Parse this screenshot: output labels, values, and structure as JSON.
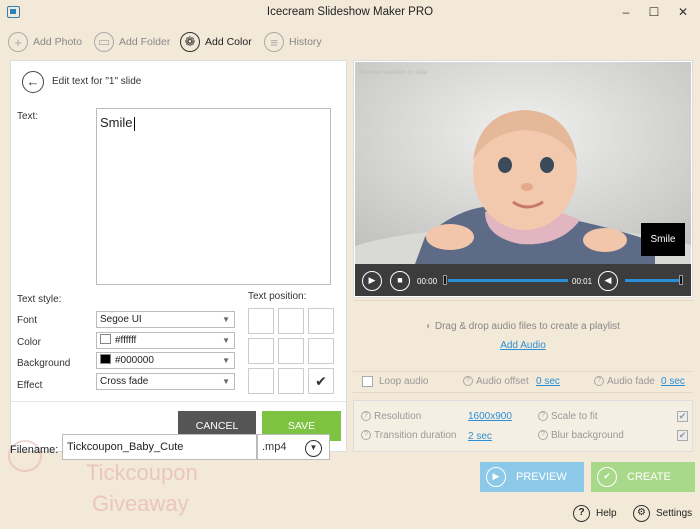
{
  "window": {
    "title": "Icecream Slideshow Maker PRO"
  },
  "toolbar": {
    "add_photo": "Add Photo",
    "add_folder": "Add Folder",
    "add_color": "Add Color",
    "history": "History"
  },
  "editor": {
    "title": "Edit text for \"1\" slide",
    "text_label": "Text:",
    "text_value": "Smile",
    "text_style_label": "Text style:",
    "text_position_label": "Text position:",
    "font_label": "Font",
    "font_value": "Segoe UI",
    "color_label": "Color",
    "color_value": "#ffffff",
    "background_label": "Background",
    "background_value": "#000000",
    "effect_label": "Effect",
    "effect_value": "Cross fade",
    "selected_position": "bottom-right",
    "cancel": "CANCEL",
    "save": "SAVE"
  },
  "preview": {
    "caption": "Preview transition to slide",
    "overlay_text": "Smile",
    "time_start": "00:00",
    "time_end": "00:01"
  },
  "audio": {
    "drag_text": "Drag & drop audio files to create a playlist",
    "add_audio": "Add Audio",
    "loop_audio": "Loop audio",
    "audio_offset_label": "Audio offset",
    "audio_offset_value": "0 sec",
    "audio_fade_label": "Audio fade",
    "audio_fade_value": "0 sec"
  },
  "settings": {
    "resolution_label": "Resolution",
    "resolution_value": "1600x900",
    "transition_label": "Transition duration",
    "transition_value": "2 sec",
    "scale_label": "Scale to fit",
    "blur_label": "Blur background"
  },
  "output": {
    "filename_label": "Filename:",
    "filename_value": "Tickcoupon_Baby_Cute",
    "extension": ".mp4",
    "preview_btn": "PREVIEW",
    "create_btn": "CREATE"
  },
  "footer": {
    "help": "Help",
    "settings": "Settings"
  },
  "watermark": {
    "line1": "Tickcoupon",
    "line2": "Giveaway"
  },
  "colors": {
    "accent_blue": "#2a8fd6",
    "save_green": "#7dc341",
    "window_bg": "#f2e9d8"
  }
}
